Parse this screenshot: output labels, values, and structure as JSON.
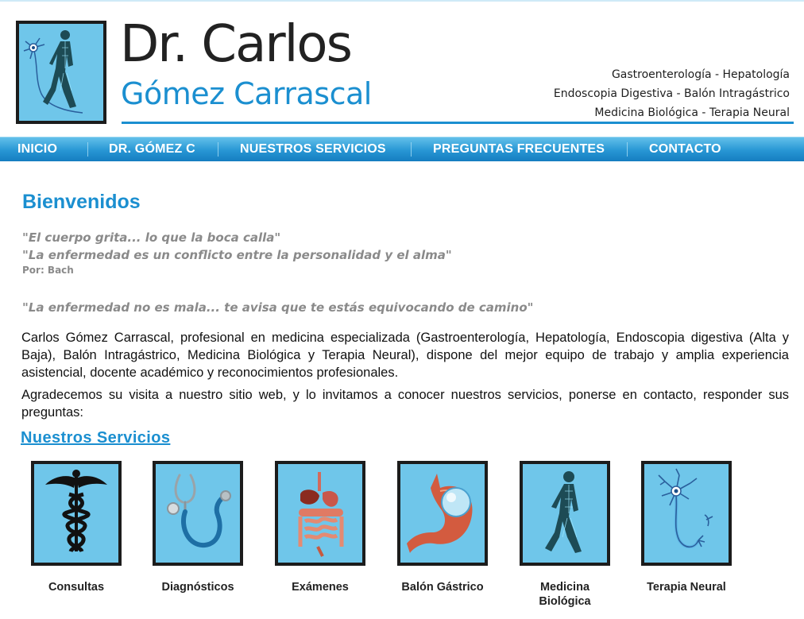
{
  "header": {
    "title_line1": "Dr. Carlos",
    "title_line2": "Gómez Carrascal",
    "specialties": [
      "Gastroenterología - Hepatología",
      "Endoscopia Digestiva - Balón Intragástrico",
      "Medicina Biológica - Terapia Neural"
    ],
    "logo_icon": "walking-figure-neuron-icon",
    "brand_color": "#1b8fd0",
    "tile_color": "#6fc6ea"
  },
  "nav": {
    "items": [
      {
        "label": "INICIO"
      },
      {
        "label": "DR. GÓMEZ C"
      },
      {
        "label": "NUESTROS SERVICIOS"
      },
      {
        "label": "PREGUNTAS FRECUENTES"
      },
      {
        "label": "CONTACTO"
      }
    ]
  },
  "main": {
    "welcome_title": "Bienvenidos",
    "quote1_line1": "\"El cuerpo grita... lo que la boca calla\"",
    "quote1_line2": "\"La enfermedad es un conflicto entre la personalidad y el alma\"",
    "quote1_author": "Por: Bach",
    "quote2": "\"La enfermedad no es mala... te avisa que te estás equivocando de camino\"",
    "paragraph1": "Carlos Gómez Carrascal, profesional en medicina especializada (Gastroenterología, Hepatología, Endoscopia digestiva (Alta y Baja), Balón Intragástrico, Medicina Biológica y Terapia Neural), dispone del mejor equipo de trabajo y amplia experiencia asistencial, docente académico y reconocimientos profesionales.",
    "paragraph2": "Agradecemos su visita a nuestro sitio web, y lo invitamos a conocer nuestros servicios, ponerse en contacto, responder sus preguntas:",
    "services_heading": "Nuestros Servicios"
  },
  "services": [
    {
      "label": "Consultas",
      "icon": "caduceus-icon"
    },
    {
      "label": "Diagnósticos",
      "icon": "stethoscope-icon"
    },
    {
      "label": "Exámenes",
      "icon": "digestive-system-icon"
    },
    {
      "label": "Balón Gástrico",
      "icon": "gastric-balloon-icon"
    },
    {
      "label": "Medicina Biológica",
      "icon": "walking-figure-icon"
    },
    {
      "label": "Terapia Neural",
      "icon": "neuron-icon"
    }
  ]
}
